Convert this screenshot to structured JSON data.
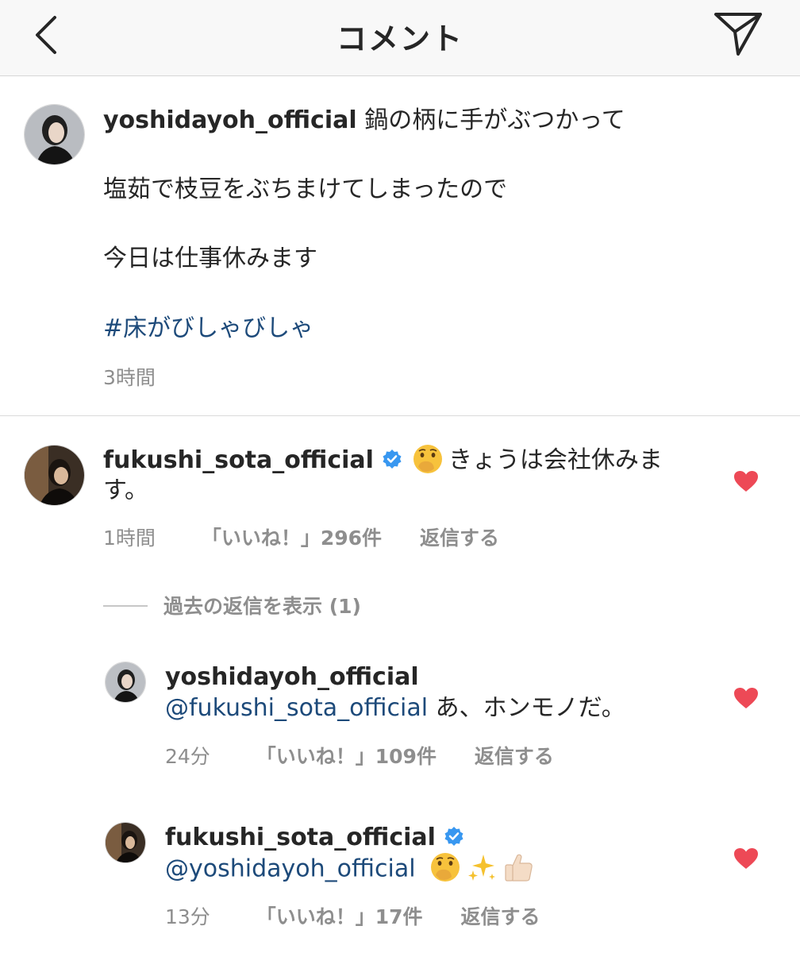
{
  "header": {
    "title": "コメント",
    "back_icon": "chevron-left-icon",
    "send_icon": "paper-plane-icon"
  },
  "caption": {
    "username": "yoshidayoh_official",
    "lines": [
      "鍋の柄に手がぶつかって",
      "塩茹で枝豆をぶちまけてしまったので",
      "今日は仕事休みます",
      "#床がびしゃびしゃ"
    ],
    "time": "3時間"
  },
  "comment": {
    "username": "fukushi_sota_official",
    "verified": true,
    "emoji_icon": "shushing-face-emoji",
    "text_line1": "きょうは会社休みま",
    "text_line2": "す。",
    "time": "1時間",
    "likes": "「いいね！」296件",
    "reply_label": "返信する",
    "liked": true
  },
  "view_replies": {
    "label": "過去の返信を表示 (1)"
  },
  "replies": [
    {
      "username": "yoshidayoh_official",
      "mention": "@fukushi_sota_official",
      "text": " あ、ホンモノだ。",
      "time": "24分",
      "likes": "「いいね！」109件",
      "reply_label": "返信する",
      "liked": true
    },
    {
      "username": "fukushi_sota_official",
      "verified": true,
      "mention": "@yoshidayoh_official",
      "emojis": [
        "shushing-face-emoji",
        "sparkles-emoji",
        "thumbs-up-emoji"
      ],
      "time": "13分",
      "likes": "「いいね！」17件",
      "reply_label": "返信する",
      "liked": true
    }
  ],
  "colors": {
    "text": "#262626",
    "secondary": "#8e8e8e",
    "link": "#1d4a7a",
    "heart": "#ed4956",
    "verified": "#3897f0",
    "header_bg": "#f8f8f8"
  }
}
